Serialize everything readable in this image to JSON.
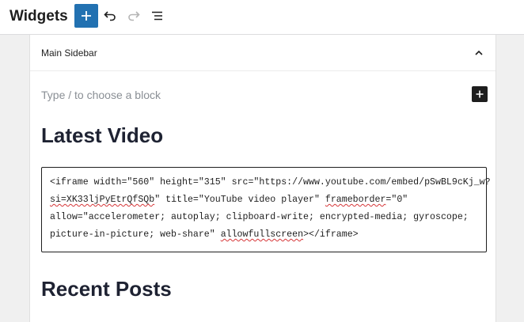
{
  "header": {
    "title": "Widgets",
    "add_icon": "plus-icon",
    "undo_icon": "undo-icon",
    "redo_icon": "redo-icon",
    "list_view_icon": "list-view-icon",
    "accent_color": "#2271b1"
  },
  "widget_area": {
    "title": "Main Sidebar",
    "toggle_icon": "chevron-up-icon"
  },
  "content": {
    "placeholder": "Type / to choose a block",
    "inserter_icon": "plus-icon",
    "heading_1": "Latest Video",
    "html_code": {
      "line_1": "<iframe width=\"560\" height=\"315\" src=\"https://www.youtube.com/embed/pSwBL9cKj_w?",
      "line_2_a": "si=XK33ljPyEtrQfSQb",
      "line_2_b": "\" title=\"YouTube video player\" ",
      "line_2_c": "frameborder",
      "line_2_d": "=\"0\"",
      "line_3": "allow=\"accelerometer; autoplay; clipboard-write; encrypted-media; gyroscope;",
      "line_4_a": "picture-in-picture; web-share\" ",
      "line_4_b": "allowfullscreen",
      "line_4_c": "></iframe>"
    },
    "heading_2": "Recent Posts"
  }
}
